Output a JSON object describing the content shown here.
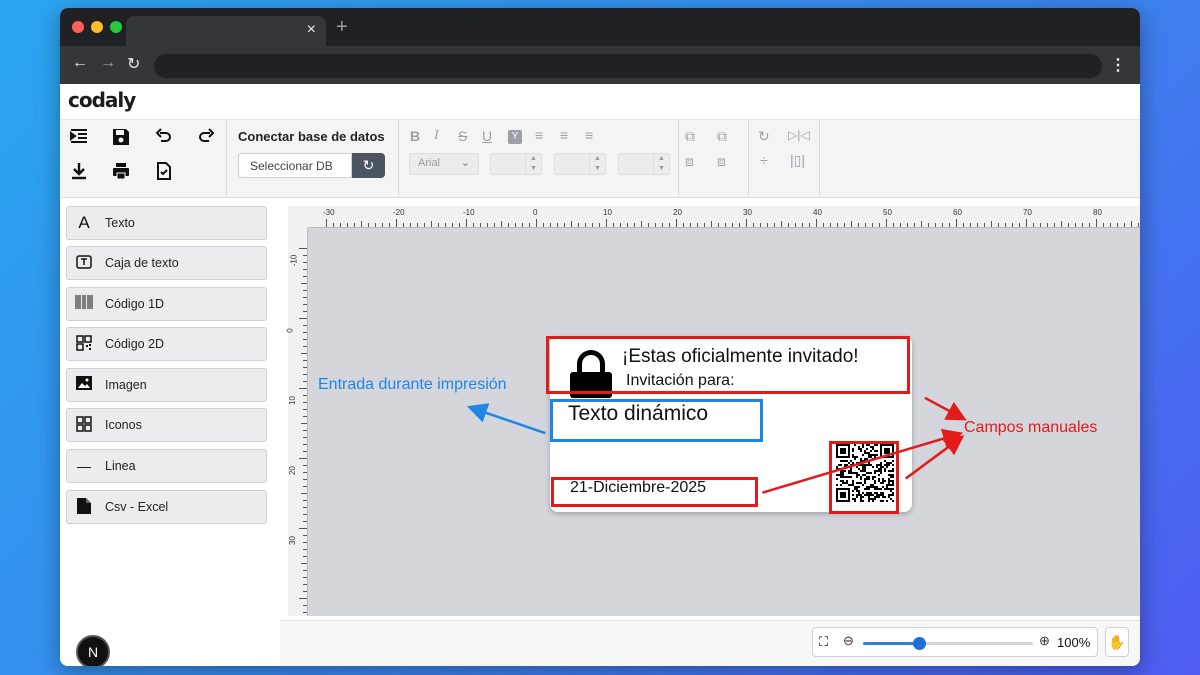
{
  "browser": {
    "tab_close": "×",
    "new_tab": "+",
    "back": "←",
    "forward": "→",
    "reload": "↻",
    "menu": "⋮"
  },
  "app": {
    "logo": "codaly",
    "colors": {
      "accent": "#2f7de1",
      "highlight_red": "#e31b1b",
      "highlight_blue": "#1e86e6"
    }
  },
  "toolbar": {
    "connect_title": "Conectar base de datos",
    "db_select": "Seleccionar DB",
    "font": "Arial",
    "format_icons": [
      "bold-icon",
      "italic-icon",
      "strikethrough-icon",
      "underline-icon",
      "highlight-icon",
      "align-left-icon",
      "align-center-icon",
      "align-right-icon"
    ]
  },
  "sidebar": {
    "items": [
      {
        "label": "Texto",
        "icon": "text-icon"
      },
      {
        "label": "Caja de texto",
        "icon": "textbox-icon"
      },
      {
        "label": "Código 1D",
        "icon": "barcode-icon"
      },
      {
        "label": "Código 2D",
        "icon": "qr-icon"
      },
      {
        "label": "Imagen",
        "icon": "image-icon"
      },
      {
        "label": "Iconos",
        "icon": "grid-icon"
      },
      {
        "label": "Linea",
        "icon": "line-icon"
      },
      {
        "label": "Csv - Excel",
        "icon": "file-icon"
      }
    ],
    "badge": "N"
  },
  "ruler": {
    "top_labels": [
      "-30",
      "-20",
      "-10",
      "0",
      "10",
      "20",
      "30",
      "40",
      "50",
      "60",
      "70",
      "80"
    ],
    "left_labels": [
      "-10",
      "0",
      "10",
      "20",
      "30"
    ]
  },
  "label": {
    "title": "¡Estas oficialmente invitado!",
    "subtitle": "Invitación para:",
    "dynamic_text": "Texto dinámico",
    "date": "21-Diciembre-2025"
  },
  "annotations": {
    "print_input": "Entrada durante impresión",
    "manual_fields": "Campos manuales"
  },
  "zoom": {
    "value": "100%",
    "level": 0.33
  }
}
